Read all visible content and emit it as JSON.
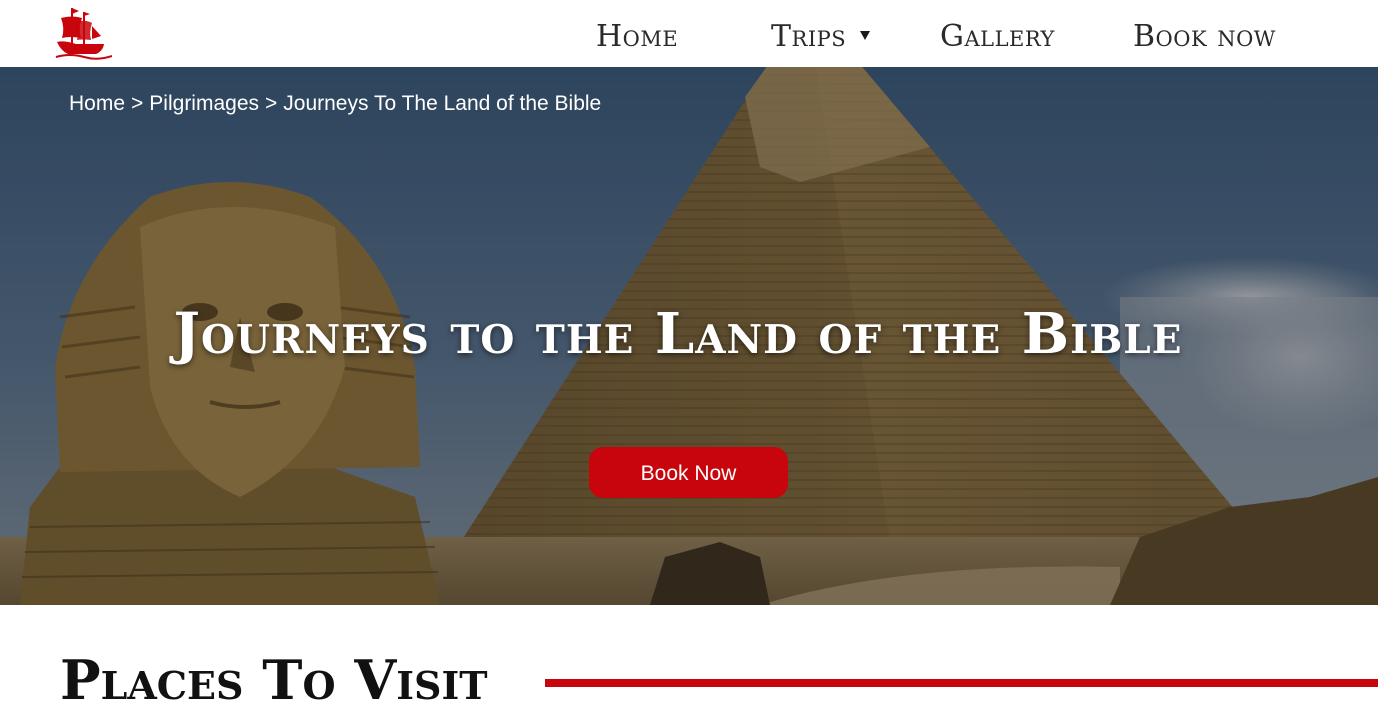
{
  "brand": {
    "logo_icon": "sailing-ship-icon",
    "accent_color": "#c8050c"
  },
  "nav": {
    "home": "Home",
    "trips": "Trips",
    "gallery": "Gallery",
    "book_now": "Book now"
  },
  "breadcrumb": {
    "items": [
      "Home",
      "Pilgrimages",
      "Journeys To The Land of the Bible"
    ],
    "separator": ">"
  },
  "hero": {
    "title": "Journeys to the Land of the Bible",
    "button_label": "Book Now",
    "background_image": "sphinx-and-pyramid-photo"
  },
  "places": {
    "title": "Places To Visit"
  }
}
